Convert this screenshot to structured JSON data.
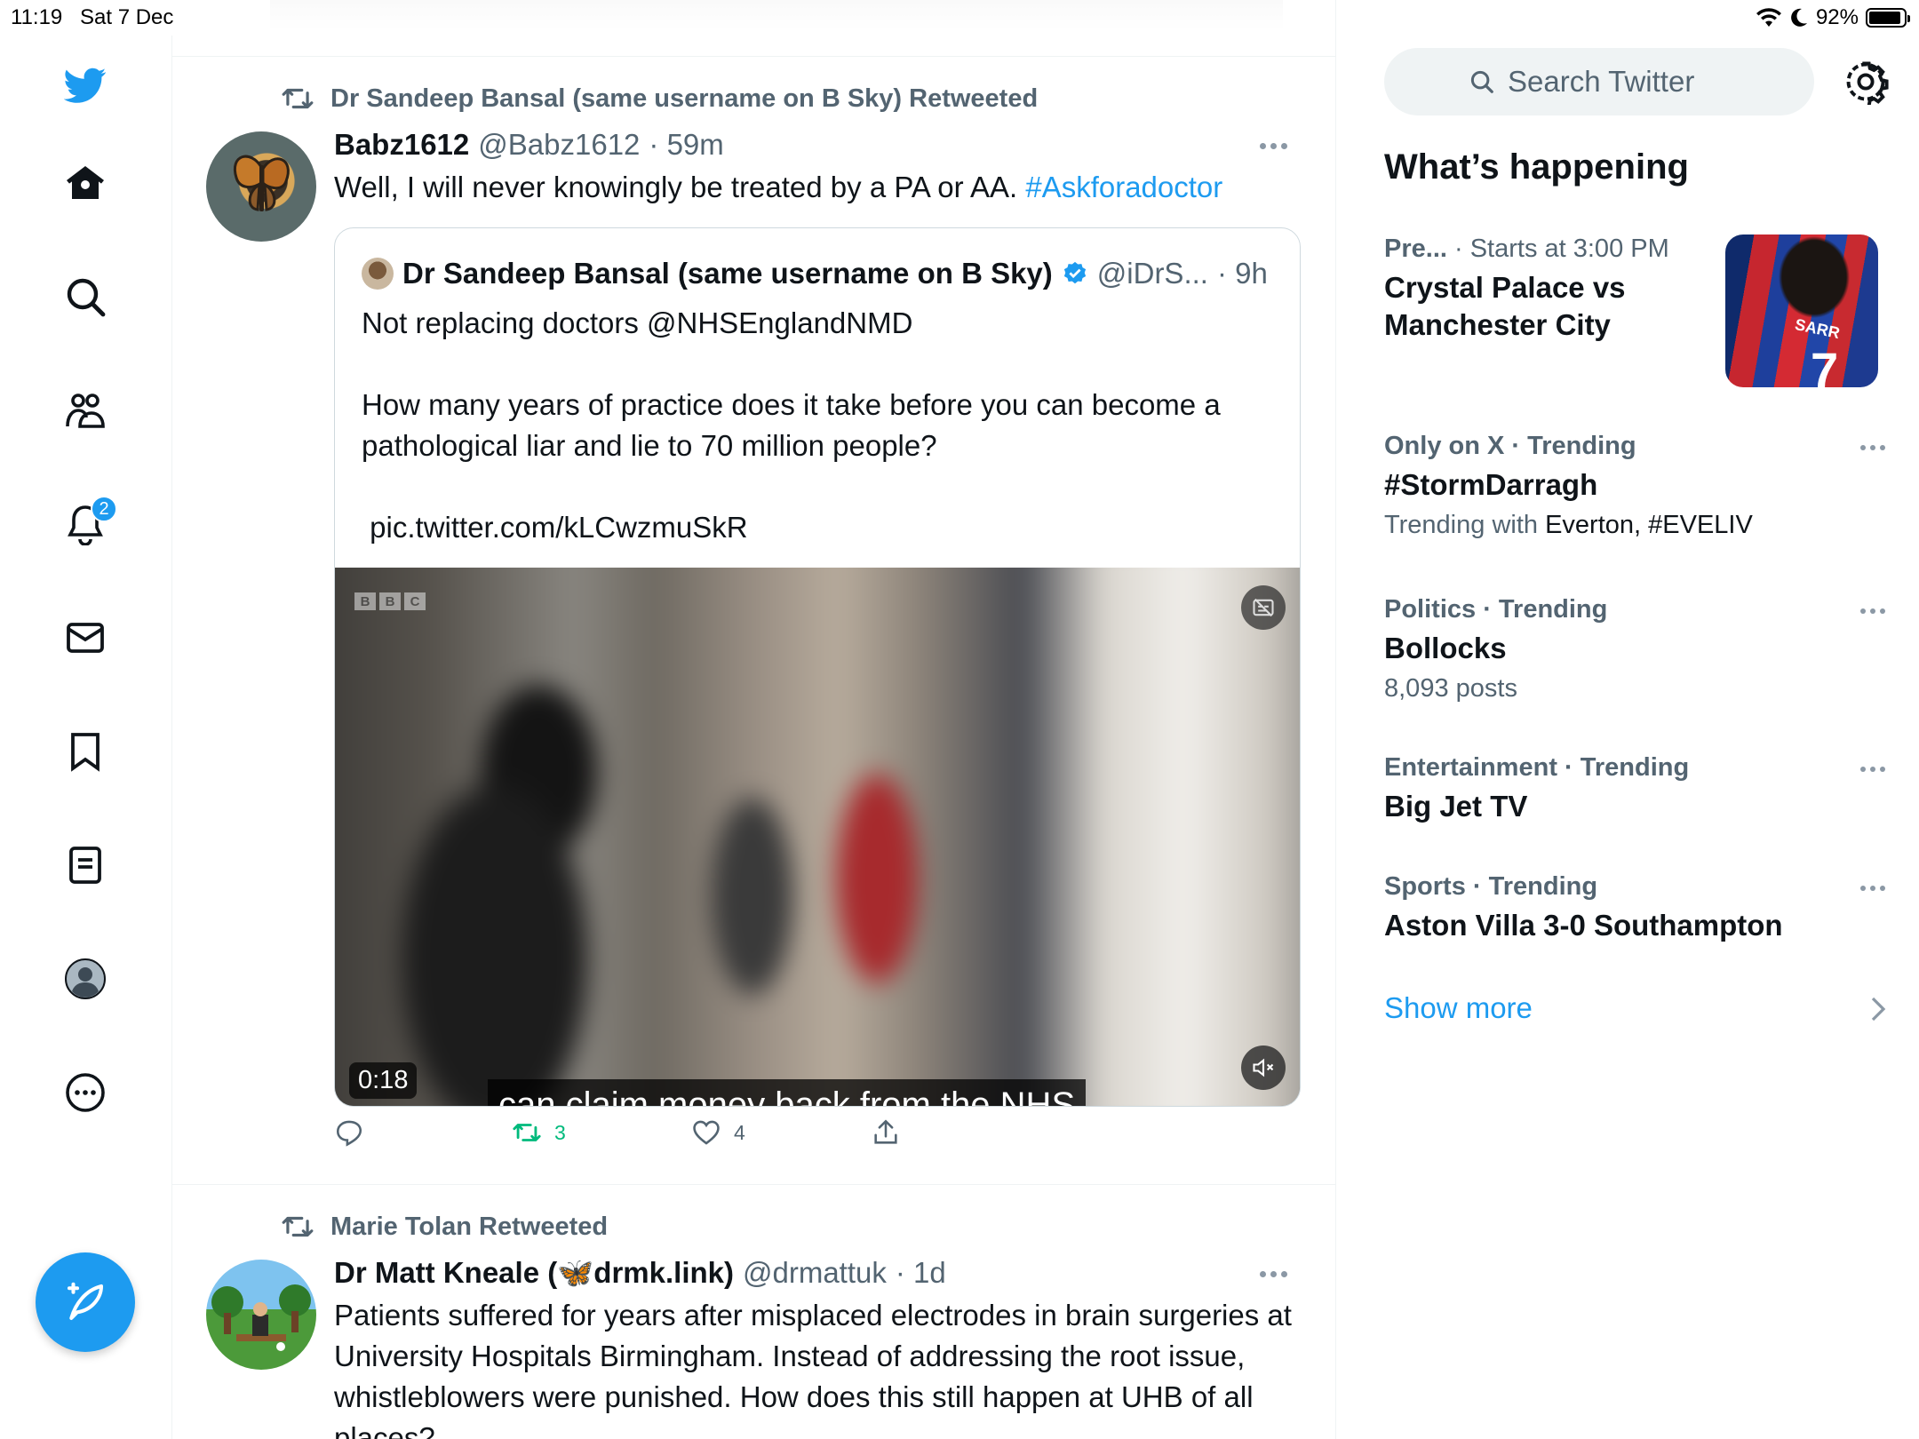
{
  "status_bar": {
    "time": "11:19",
    "date": "Sat 7 Dec",
    "battery": "92%",
    "battery_level": 0.92
  },
  "nav": {
    "notifications_badge": "2",
    "items": [
      "twitter-logo",
      "home-icon",
      "search-icon",
      "communities-icon",
      "notifications-icon",
      "messages-icon",
      "bookmarks-icon",
      "lists-icon",
      "profile-icon",
      "more-icon"
    ]
  },
  "tweets": [
    {
      "retweeted_by": "Dr Sandeep Bansal (same username on B Sky) Retweeted",
      "name": "Babz1612",
      "handle": "@Babz1612",
      "time": "· 59m",
      "text": "Well, I will never knowingly be treated by a PA or AA. ",
      "hashtag": "#Askforadoctor",
      "quote": {
        "name": "Dr Sandeep Bansal (same username on B Sky)",
        "handle": "@iDrS...",
        "time": "· 9h",
        "text": "Not replacing doctors @NHSEnglandNMD\n\nHow many years of practice does it take before you can become a pathological liar and lie to 70 million people?\n\n pic.twitter.com/kLCwzmuSkR",
        "media": {
          "duration": "0:18",
          "subtitle": "can claim money back from the NHS",
          "watermark": [
            "B",
            "B",
            "C"
          ]
        }
      },
      "actions": {
        "reply": "",
        "retweets": "3",
        "likes": "4",
        "share": ""
      }
    },
    {
      "retweeted_by": "Marie Tolan Retweeted",
      "name": "Dr Matt Kneale (🦋drmk.link)",
      "handle": "@drmattuk",
      "time": "· 1d",
      "text": "Patients suffered for years after misplaced electrodes in brain surgeries at University Hospitals Birmingham. Instead of addressing the root issue, whistleblowers were punished. How does this still happen at UHB of all places?"
    }
  ],
  "sidebar": {
    "search_placeholder": "Search Twitter",
    "whats_happening": "What’s happening",
    "trends": [
      {
        "category": "Pre...",
        "meta_suffix": " · Starts at 3:00 PM",
        "title": "Crystal Palace vs Manchester City",
        "image_text": "SARR",
        "image_number": "7"
      },
      {
        "category": "Only on X · Trending",
        "title": "#StormDarragh",
        "sub_prefix": "Trending with ",
        "sub_dark": "Everton, #EVELIV"
      },
      {
        "category": "Politics · Trending",
        "title": "Bollocks",
        "sub": "8,093 posts"
      },
      {
        "category": "Entertainment · Trending",
        "title": "Big Jet TV"
      },
      {
        "category": "Sports · Trending",
        "title": "Aston Villa 3-0 Southampton"
      }
    ],
    "show_more": "Show more"
  },
  "colors": {
    "accent": "#1d9bf0",
    "retweet_green": "#00ba7c",
    "secondary_text": "#536471",
    "primary_text": "#0f1419"
  }
}
